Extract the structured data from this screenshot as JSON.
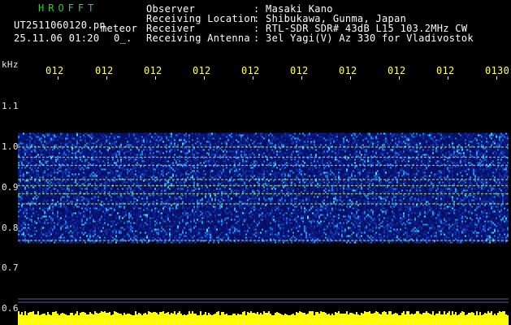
{
  "header": {
    "logo": "HROFFT",
    "filename": "UT2511060120.pn",
    "tag": "meteor",
    "datetime": "25.11.06 01:20",
    "code": "0_.",
    "fields": [
      {
        "label": "Observer",
        "value": ": Masaki Kano"
      },
      {
        "label": "Receiving Location",
        "value": ": Shibukawa, Gunma, Japan"
      },
      {
        "label": "Receiver",
        "value": ": RTL-SDR SDR# 43dB L15 103.2MHz CW"
      },
      {
        "label": "Receiving Antenna",
        "value": ": 3el Yagi(V) Az 330 for Vladivostok"
      }
    ]
  },
  "chart_data": {
    "type": "heatmap",
    "ylabel": "kHz",
    "y_tick_labels": [
      "1.1",
      "1.0",
      "0.9",
      "0.8",
      "0.7",
      "0.6"
    ],
    "y_ticks": [
      1.1,
      1.0,
      0.9,
      0.8,
      0.7,
      0.6
    ],
    "ylim": [
      0.6,
      1.17
    ],
    "x_tick_labels": [
      "012",
      "012",
      "012",
      "012",
      "012",
      "012",
      "012",
      "012",
      "012",
      "0130"
    ],
    "noise_band": [
      0.765,
      1.035
    ],
    "bright_lines": [
      0.77,
      0.86,
      0.885,
      0.905,
      0.92,
      0.955,
      0.975,
      1.0
    ],
    "colors": {
      "background": "#000000",
      "noise_low": "#0a1a8c",
      "noise_mid": "#1f7ad9",
      "noise_high": "#48e0e0",
      "line": "#c8f060",
      "bottom_strip": "#ffff00",
      "axis_labels": "#ffff66",
      "logo": "#2ecc3a"
    }
  }
}
